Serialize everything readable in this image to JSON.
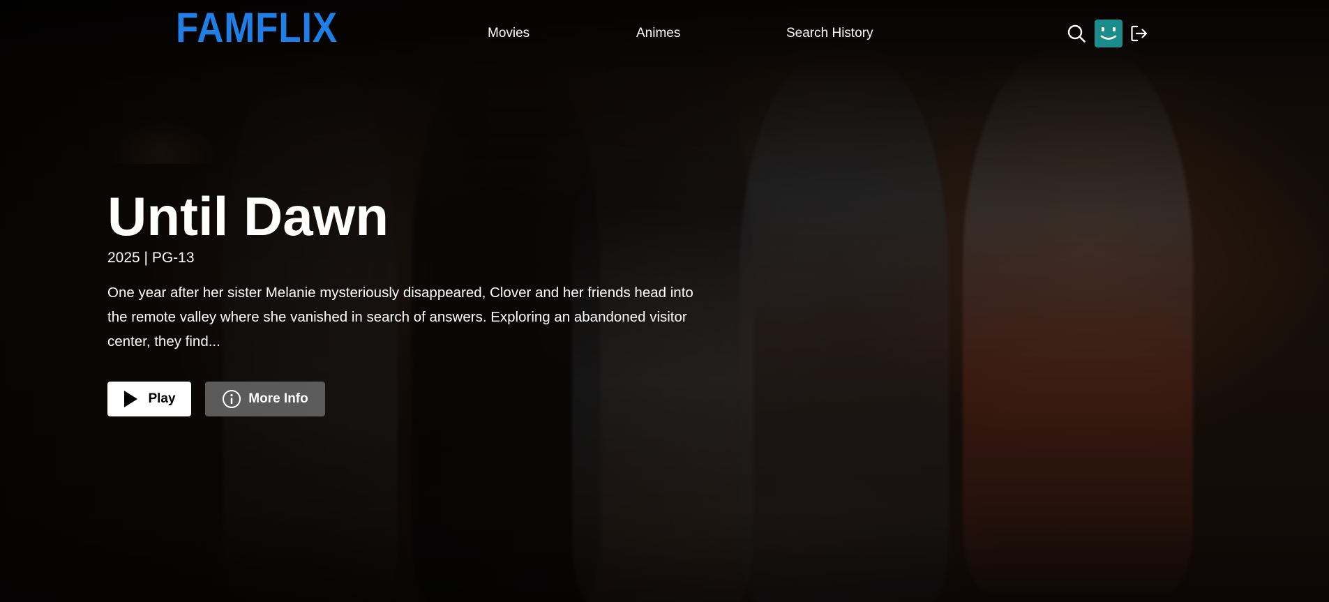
{
  "brand": {
    "logo": "FAMFLIX",
    "color": "#1f7fe6"
  },
  "nav": {
    "links": [
      {
        "label": "Movies"
      },
      {
        "label": "Animes"
      },
      {
        "label": "Search History"
      }
    ],
    "icons": [
      "search-icon",
      "avatar",
      "sign-out-icon"
    ],
    "avatar_color": "#1a8c8c"
  },
  "featured": {
    "title": "Until Dawn",
    "meta": "2025 | PG-13",
    "description": "One year after her sister Melanie mysteriously disappeared, Clover and her friends head into the remote valley where she vanished in search of answers. Exploring an abandoned visitor center, they find...",
    "play_label": "Play",
    "info_label": "More Info"
  }
}
